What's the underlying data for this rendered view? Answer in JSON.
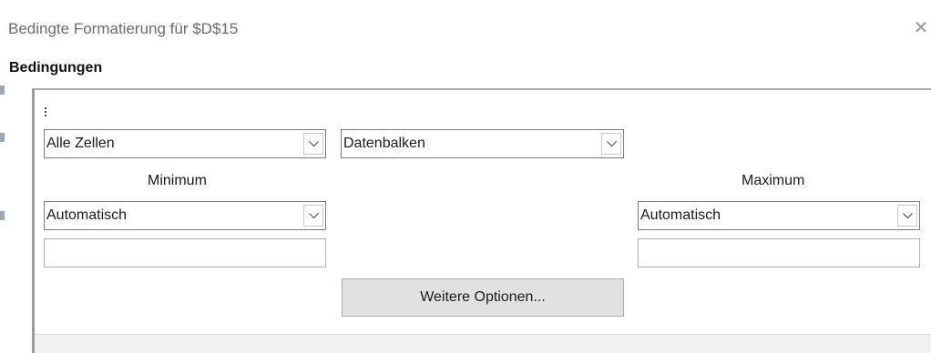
{
  "window": {
    "title": "Bedingte Formatierung für $D$15",
    "close_symbol": "✕"
  },
  "section": {
    "title": "Bedingungen"
  },
  "condition": {
    "scope_select": {
      "value": "Alle Zellen"
    },
    "type_select": {
      "value": "Datenbalken"
    },
    "minimum": {
      "label": "Minimum",
      "type_select": {
        "value": "Automatisch"
      },
      "value_input": {
        "value": ""
      }
    },
    "maximum": {
      "label": "Maximum",
      "type_select": {
        "value": "Automatisch"
      },
      "value_input": {
        "value": ""
      }
    },
    "more_options_label": "Weitere Optionen..."
  },
  "icons": {
    "dropdown": "chevron-down-icon",
    "close": "close-icon",
    "drag": "drag-handle-icon"
  }
}
